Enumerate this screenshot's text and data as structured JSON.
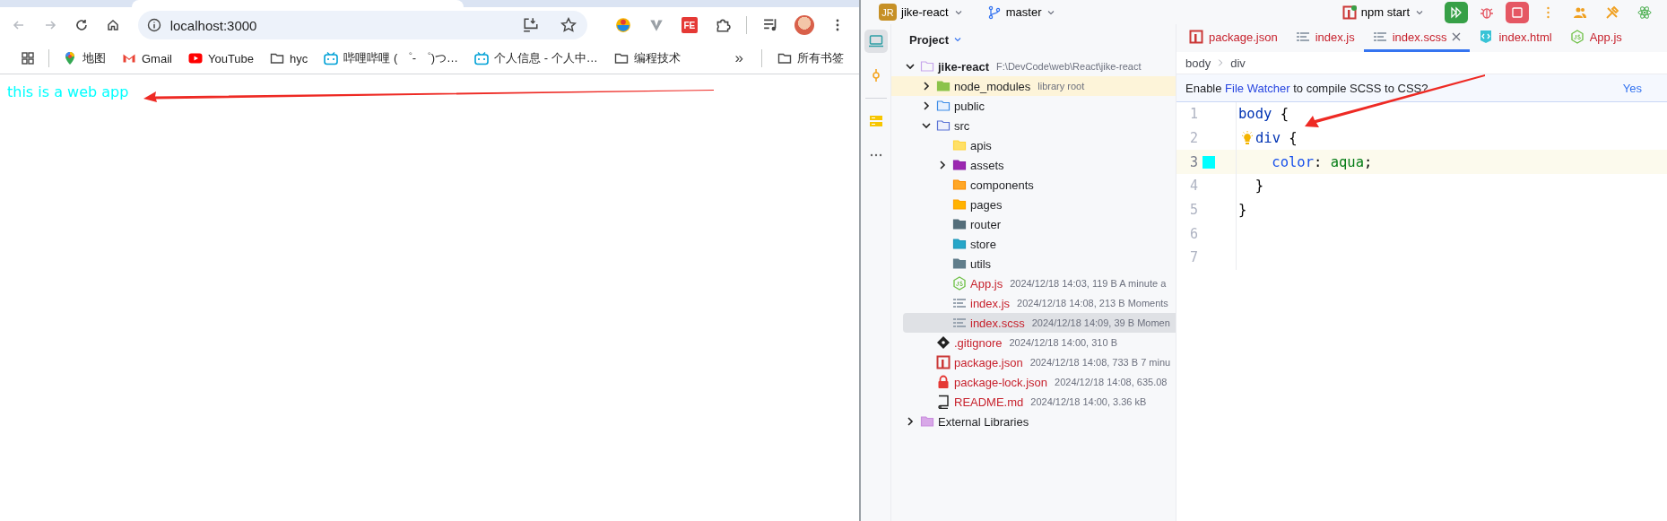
{
  "browser": {
    "nav": [
      {
        "kind": "back",
        "disabled": true
      },
      {
        "kind": "forward",
        "disabled": true
      },
      {
        "kind": "reload",
        "disabled": false
      },
      {
        "kind": "home",
        "disabled": false
      }
    ],
    "address": "localhost:3000",
    "extensions": [
      {
        "kind": "ring"
      },
      {
        "kind": "vee"
      },
      {
        "kind": "badge",
        "label": "FE"
      },
      {
        "kind": "puzzle"
      }
    ],
    "bookmarks": [
      {
        "kind": "apps"
      },
      {
        "kind": "maps",
        "label": "地图"
      },
      {
        "kind": "gmail",
        "label": "Gmail"
      },
      {
        "kind": "youtube",
        "label": "YouTube"
      },
      {
        "kind": "folder",
        "label": "hyc"
      },
      {
        "kind": "tv",
        "label": "哔哩哔哩 ( ゜- ゜)つ…"
      },
      {
        "kind": "tv",
        "label": "个人信息 - 个人中…"
      },
      {
        "kind": "folder",
        "label": "编程技术"
      }
    ],
    "overflow": "»",
    "all_bookmarks": "所有书签",
    "page_text": "this is a web app"
  },
  "ide": {
    "project_badge": "JR",
    "project": "jike-react",
    "branch": "master",
    "run_config": "npm start",
    "tool_windows": [
      {
        "kind": "project",
        "selected": true
      },
      {
        "kind": "commit",
        "selected": false
      },
      {
        "kind": "structure",
        "selected": false
      },
      {
        "kind": "more",
        "selected": false
      }
    ],
    "panel_title": "Project",
    "tree": [
      {
        "name": "jike-react",
        "kind": "project-folder",
        "detail": "F:\\DevCode\\web\\React\\jike-react",
        "expanded": true,
        "selected": false,
        "highlighted": false,
        "untracked": false,
        "children": [
          {
            "name": "node_modules",
            "kind": "lib-folder",
            "detail": "library root",
            "expanded": false,
            "selected": false,
            "highlighted": true,
            "untracked": false
          },
          {
            "name": "public",
            "kind": "web-folder",
            "expanded": false,
            "selected": false,
            "highlighted": false,
            "untracked": false
          },
          {
            "name": "src",
            "kind": "source-folder",
            "expanded": true,
            "selected": false,
            "highlighted": false,
            "untracked": false,
            "children": [
              {
                "name": "apis",
                "kind": "api-folder",
                "selected": false,
                "highlighted": false,
                "untracked": false
              },
              {
                "name": "assets",
                "kind": "assets-folder",
                "expanded": false,
                "selected": false,
                "highlighted": false,
                "untracked": false
              },
              {
                "name": "components",
                "kind": "components-folder",
                "selected": false,
                "highlighted": false,
                "untracked": false
              },
              {
                "name": "pages",
                "kind": "pages-folder",
                "selected": false,
                "highlighted": false,
                "untracked": false
              },
              {
                "name": "router",
                "kind": "router-folder",
                "selected": false,
                "highlighted": false,
                "untracked": false
              },
              {
                "name": "store",
                "kind": "store-folder",
                "selected": false,
                "highlighted": false,
                "untracked": false
              },
              {
                "name": "utils",
                "kind": "utils-folder",
                "selected": false,
                "highlighted": false,
                "untracked": false
              },
              {
                "name": "App.js",
                "kind": "js",
                "detail": "2024/12/18 14:03, 119 B A minute a",
                "selected": false,
                "highlighted": false,
                "untracked": true
              },
              {
                "name": "index.js",
                "kind": "lines",
                "detail": "2024/12/18 14:08, 213 B Moments",
                "selected": false,
                "highlighted": false,
                "untracked": true
              },
              {
                "name": "index.scss",
                "kind": "lines",
                "detail": "2024/12/18 14:09, 39 B Momen",
                "selected": true,
                "highlighted": false,
                "untracked": true
              }
            ]
          },
          {
            "name": ".gitignore",
            "kind": "git",
            "detail": "2024/12/18 14:00, 310 B",
            "selected": false,
            "highlighted": false,
            "untracked": true
          },
          {
            "name": "package.json",
            "kind": "npm",
            "detail": "2024/12/18 14:08, 733 B 7 minu",
            "selected": false,
            "highlighted": false,
            "untracked": true
          },
          {
            "name": "package-lock.json",
            "kind": "lock",
            "detail": "2024/12/18 14:08, 635.08",
            "selected": false,
            "highlighted": false,
            "untracked": true
          },
          {
            "name": "README.md",
            "kind": "book",
            "detail": "2024/12/18 14:00, 3.36 kB",
            "selected": false,
            "highlighted": false,
            "untracked": true
          }
        ]
      },
      {
        "name": "External Libraries",
        "kind": "library",
        "expanded": false,
        "selected": false,
        "highlighted": false,
        "untracked": false
      }
    ],
    "tabs": [
      {
        "label": "package.json",
        "kind": "npm",
        "selected": false,
        "closable": false,
        "untracked": true
      },
      {
        "label": "index.js",
        "kind": "lines",
        "selected": false,
        "closable": false,
        "untracked": true
      },
      {
        "label": "index.scss",
        "kind": "lines",
        "selected": true,
        "closable": true,
        "untracked": true
      },
      {
        "label": "index.html",
        "kind": "html",
        "selected": false,
        "closable": false,
        "untracked": true
      },
      {
        "label": "App.js",
        "kind": "js",
        "selected": false,
        "closable": false,
        "untracked": true
      }
    ],
    "breadcrumbs": [
      "body",
      "div"
    ],
    "notification": {
      "before": "Enable ",
      "link": "File Watcher",
      "after": " to compile SCSS to CSS?",
      "action": "Yes"
    },
    "lines": [
      {
        "number": "1",
        "current": false,
        "hint": false,
        "tokens": [
          {
            "kind": "selector",
            "text": "body"
          },
          {
            "kind": "punct",
            "text": " {"
          }
        ]
      },
      {
        "number": "2",
        "current": false,
        "hint": true,
        "tokens": [
          {
            "kind": "selector",
            "text": "div"
          },
          {
            "kind": "punct",
            "text": " {"
          }
        ]
      },
      {
        "number": "3",
        "current": true,
        "hint": false,
        "color": "#00ffff",
        "tokens": [
          {
            "kind": "property",
            "text": "    color"
          },
          {
            "kind": "punct",
            "text": ": "
          },
          {
            "kind": "value",
            "text": "aqua"
          },
          {
            "kind": "punct",
            "text": ";"
          }
        ]
      },
      {
        "number": "4",
        "current": false,
        "hint": false,
        "tokens": [
          {
            "kind": "punct",
            "text": "  }"
          }
        ]
      },
      {
        "number": "5",
        "current": false,
        "hint": false,
        "tokens": [
          {
            "kind": "punct",
            "text": "}"
          }
        ]
      },
      {
        "number": "6",
        "current": false,
        "hint": false
      },
      {
        "number": "7",
        "current": false,
        "hint": false
      }
    ]
  }
}
